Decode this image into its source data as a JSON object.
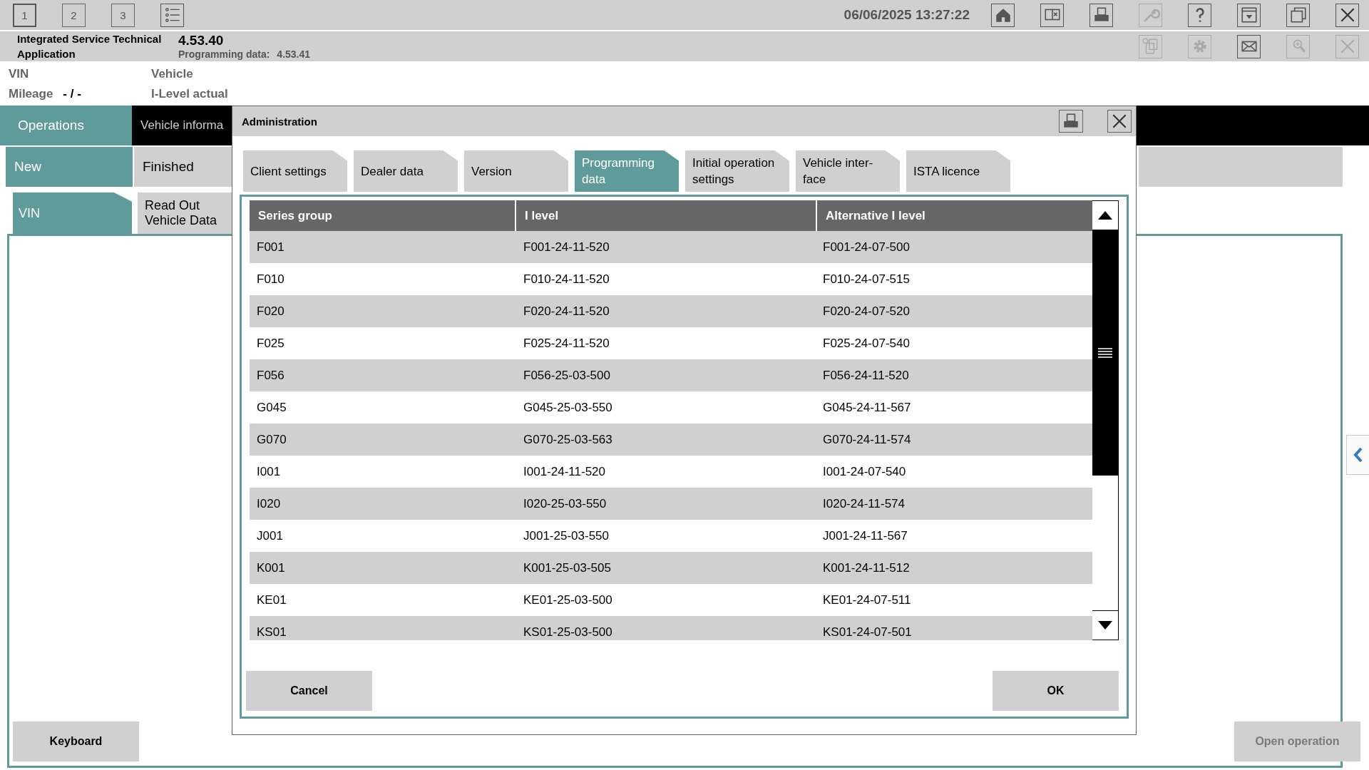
{
  "top_bar": {
    "views": [
      {
        "label": "1",
        "selected": true
      },
      {
        "label": "2",
        "selected": false
      },
      {
        "label": "3",
        "selected": false
      }
    ],
    "datetime": "06/06/2025 13:27:22",
    "tools": [
      {
        "kind": "home",
        "disabled": false
      },
      {
        "kind": "reader",
        "disabled": false
      },
      {
        "kind": "print",
        "disabled": false
      },
      {
        "kind": "wrench",
        "disabled": true
      },
      {
        "kind": "help",
        "disabled": false
      },
      {
        "kind": "collapse",
        "disabled": false
      },
      {
        "kind": "windows",
        "disabled": false
      },
      {
        "kind": "close",
        "disabled": false
      }
    ]
  },
  "app_bar": {
    "title": "Integrated Service Technical Application",
    "version": "4.53.40",
    "programming_data_label": "Programming data:",
    "programming_data_version": "4.53.41",
    "tools": [
      {
        "kind": "copy",
        "disabled": true
      },
      {
        "kind": "gear",
        "disabled": true
      },
      {
        "kind": "mail",
        "disabled": false
      },
      {
        "kind": "air",
        "disabled": true
      },
      {
        "kind": "close",
        "disabled": true
      }
    ]
  },
  "vehicle_info": {
    "vin_label": "VIN",
    "mileage_label": "Mileage",
    "mileage_value": "- / -",
    "vehicle_label": "Vehicle",
    "ilevel_label": "I-Level actual"
  },
  "main_tabs": [
    {
      "label": "Operations",
      "selected": true
    },
    {
      "label": "Vehicle informa",
      "selected": false
    }
  ],
  "sub_tabs": [
    {
      "label": "New",
      "selected": true
    },
    {
      "label": "Finished",
      "selected": false
    }
  ],
  "operation_tabs": [
    {
      "label": "VIN",
      "selected": true
    },
    {
      "label": "Read Out\nVehicle Data",
      "selected": false
    }
  ],
  "keyboard_button": "Keyboard",
  "open_operation_button": {
    "label": "Open operation",
    "disabled": true
  },
  "dialog": {
    "title": "Administration",
    "tabs": [
      {
        "label": "Client settings",
        "selected": false
      },
      {
        "label": "Dealer data",
        "selected": false
      },
      {
        "label": "Version",
        "selected": false
      },
      {
        "label": "Programming\ndata",
        "selected": true
      },
      {
        "label": "Initial operation\nsettings",
        "selected": false
      },
      {
        "label": "Vehicle inter-\nface",
        "selected": false
      },
      {
        "label": "ISTA licence",
        "selected": false
      }
    ],
    "columns": [
      "Series group",
      "I level",
      "Alternative I level"
    ],
    "rows": [
      [
        "F001",
        "F001-24-11-520",
        "F001-24-07-500"
      ],
      [
        "F010",
        "F010-24-11-520",
        "F010-24-07-515"
      ],
      [
        "F020",
        "F020-24-11-520",
        "F020-24-07-520"
      ],
      [
        "F025",
        "F025-24-11-520",
        "F025-24-07-540"
      ],
      [
        "F056",
        "F056-25-03-500",
        "F056-24-11-520"
      ],
      [
        "G045",
        "G045-25-03-550",
        "G045-24-11-567"
      ],
      [
        "G070",
        "G070-25-03-563",
        "G070-24-11-574"
      ],
      [
        "I001",
        "I001-24-11-520",
        "I001-24-07-540"
      ],
      [
        "I020",
        "I020-25-03-550",
        "I020-24-11-574"
      ],
      [
        "J001",
        "J001-25-03-550",
        "J001-24-11-567"
      ],
      [
        "K001",
        "K001-25-03-505",
        "K001-24-11-512"
      ],
      [
        "KE01",
        "KE01-25-03-500",
        "KE01-24-07-511"
      ],
      [
        "KS01",
        "KS01-25-03-500",
        "KS01-24-07-501"
      ]
    ],
    "cancel_button": "Cancel",
    "ok_button": "OK"
  }
}
